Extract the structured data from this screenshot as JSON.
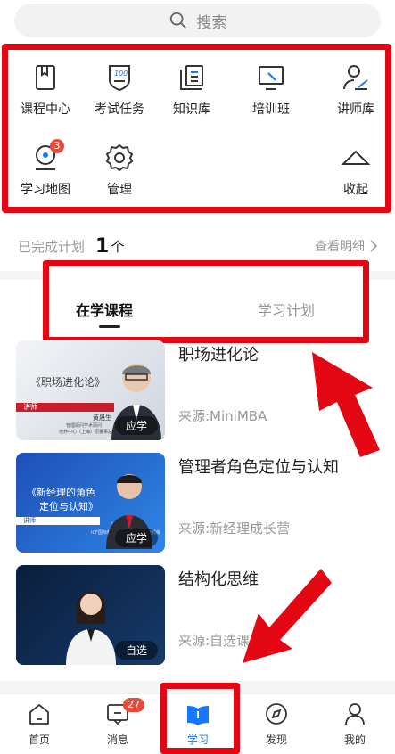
{
  "search": {
    "placeholder": "搜索"
  },
  "menu": [
    {
      "label": "课程中心",
      "icon": "book-icon"
    },
    {
      "label": "考试任务",
      "icon": "exam-shield-icon"
    },
    {
      "label": "知识库",
      "icon": "knowledge-icon"
    },
    {
      "label": "培训班",
      "icon": "monitor-icon"
    },
    {
      "label": "讲师库",
      "icon": "lecturer-icon"
    },
    {
      "label": "学习地图",
      "icon": "map-pin-icon",
      "badge": "3"
    },
    {
      "label": "管理",
      "icon": "gear-icon"
    },
    {
      "label": "收起",
      "icon": "chevron-up-icon"
    }
  ],
  "plan": {
    "label": "已完成计划",
    "count": "1",
    "unit": "个",
    "detail": "查看明细"
  },
  "tabs": {
    "learning": "在学课程",
    "plan": "学习计划"
  },
  "courses": [
    {
      "title": "职场进化论",
      "source": "来源:MiniMBA",
      "tag": "应学",
      "thumb_text": "《职场进化论》",
      "thumb_role": "讲师",
      "thumb_name": "黄晟生",
      "thumb_desc1": "管理顾问学术顾问",
      "thumb_desc2": "培养中心（上海）原董事总经理",
      "colors": [
        "#eef0f4",
        "#c9cfd9"
      ]
    },
    {
      "title": "管理者角色定位与认知",
      "source": "来源:新经理成长营",
      "tag": "应学",
      "thumb_text_line1": "《新经理的角色",
      "thumb_text_line2": "定位与认知》",
      "thumb_role": "讲师",
      "thumb_name": "沙卫华",
      "thumb_desc1": "ICF国际教练联盟认证ACC专业教练",
      "colors": [
        "#1e4fb8",
        "#2d7be0"
      ]
    },
    {
      "title": "结构化思维",
      "source": "来源:自选课",
      "tag": "自选",
      "colors": [
        "#0a1e3c",
        "#13325e"
      ]
    }
  ],
  "nav": [
    {
      "label": "首页",
      "icon": "home-icon"
    },
    {
      "label": "消息",
      "icon": "message-icon",
      "badge": "27"
    },
    {
      "label": "学习",
      "icon": "study-book-icon",
      "active": true
    },
    {
      "label": "发现",
      "icon": "compass-icon"
    },
    {
      "label": "我的",
      "icon": "user-icon"
    }
  ],
  "colors": {
    "accent": "#1677ff",
    "annotation_red": "#e30613"
  }
}
